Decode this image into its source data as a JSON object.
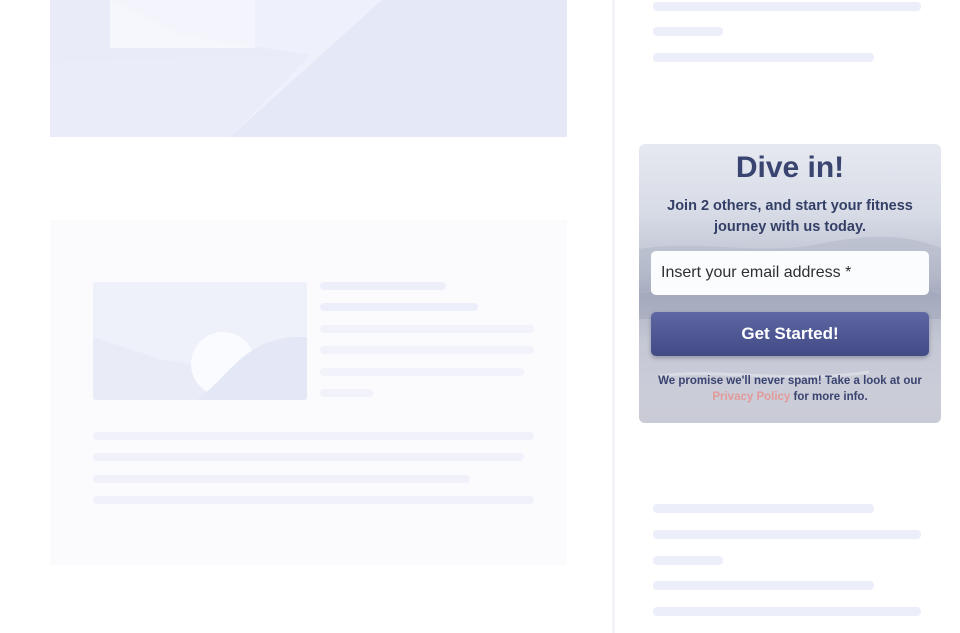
{
  "widget": {
    "title": "Dive in!",
    "subtitle": "Join 2 others, and start your fitness journey with us today.",
    "email_placeholder": "Insert your email address *",
    "cta_label": "Get Started!",
    "disclaimer_before": "We promise we'll never spam! Take a look at our",
    "privacy_link": "Privacy Policy",
    "disclaimer_after": "for more info."
  },
  "colors": {
    "title": "#3a4470",
    "button": "#4e5793",
    "link": "#e39a9a",
    "placeholder_bar": "#eceffa"
  }
}
